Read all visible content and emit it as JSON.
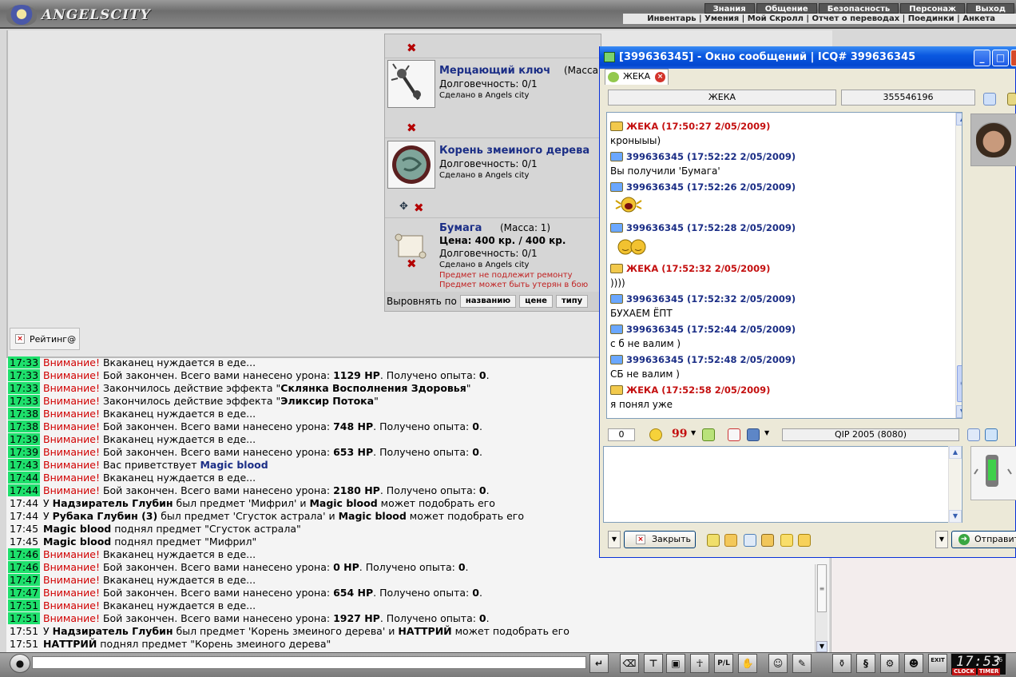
{
  "game": {
    "logo_text": "ANGELSCITY",
    "menu_top": [
      "Знания",
      "Общение",
      "Безопасность",
      "Персонаж",
      "Выход"
    ],
    "menu_sub": "Инвентарь | Умения | Мой Скролл | Отчет о переводах | Поединки | Анкета",
    "rating_label": "Рейтинг@",
    "inventory": {
      "items": [
        {
          "name": "Мерцающий ключ",
          "mass": "(Масса",
          "durability": "Долговечность: 0/1",
          "made": "Сделано в Angels city"
        },
        {
          "name": "Корень змеиного дерева",
          "durability": "Долговечность: 0/1",
          "made": "Сделано в Angels city"
        },
        {
          "name": "Бумага",
          "mass": "(Масса: 1)",
          "price": "Цена: 400 кр. / 400 кр.",
          "durability": "Долговечность: 0/1",
          "made": "Сделано в Angels city",
          "note1": "Предмет не подлежит ремонту",
          "note2": "Предмет может быть утерян в бою"
        }
      ],
      "sort_label": "Выровнять по",
      "sort_buttons": [
        "названию",
        "цене",
        "типу"
      ]
    },
    "chat": [
      {
        "time": "17:33",
        "hl": true,
        "parts": [
          [
            "w",
            "Внимание! "
          ],
          [
            "n",
            "Вкаканец нуждается в еде..."
          ]
        ]
      },
      {
        "time": "17:33",
        "hl": true,
        "parts": [
          [
            "w",
            "Внимание! "
          ],
          [
            "n",
            "Бой закончен. Всего вами нанесено урона: "
          ],
          [
            "b",
            "1129 HP"
          ],
          [
            "n",
            ". Получено опыта: "
          ],
          [
            "b",
            "0"
          ],
          [
            "n",
            "."
          ]
        ]
      },
      {
        "time": "17:33",
        "hl": true,
        "parts": [
          [
            "w",
            "Внимание! "
          ],
          [
            "n",
            "Закончилось действие эффекта \""
          ],
          [
            "b",
            "Склянка Восполнения Здоровья"
          ],
          [
            "n",
            "\""
          ]
        ]
      },
      {
        "time": "17:33",
        "hl": true,
        "parts": [
          [
            "w",
            "Внимание! "
          ],
          [
            "n",
            "Закончилось действие эффекта \""
          ],
          [
            "b",
            "Эликсир Потока"
          ],
          [
            "n",
            "\""
          ]
        ]
      },
      {
        "time": "17:38",
        "hl": true,
        "parts": [
          [
            "w",
            "Внимание! "
          ],
          [
            "n",
            "Вкаканец нуждается в еде..."
          ]
        ]
      },
      {
        "time": "17:38",
        "hl": true,
        "parts": [
          [
            "w",
            "Внимание! "
          ],
          [
            "n",
            "Бой закончен. Всего вами нанесено урона: "
          ],
          [
            "b",
            "748 HP"
          ],
          [
            "n",
            ". Получено опыта: "
          ],
          [
            "b",
            "0"
          ],
          [
            "n",
            "."
          ]
        ]
      },
      {
        "time": "17:39",
        "hl": true,
        "parts": [
          [
            "w",
            "Внимание! "
          ],
          [
            "n",
            "Вкаканец нуждается в еде..."
          ]
        ]
      },
      {
        "time": "17:39",
        "hl": true,
        "parts": [
          [
            "w",
            "Внимание! "
          ],
          [
            "n",
            "Бой закончен. Всего вами нанесено урона: "
          ],
          [
            "b",
            "653 HP"
          ],
          [
            "n",
            ". Получено опыта: "
          ],
          [
            "b",
            "0"
          ],
          [
            "n",
            "."
          ]
        ]
      },
      {
        "time": "17:43",
        "hl": true,
        "parts": [
          [
            "w",
            "Внимание! "
          ],
          [
            "n",
            "Вас приветствует "
          ],
          [
            "bl",
            "Magic blood"
          ]
        ]
      },
      {
        "time": "17:44",
        "hl": true,
        "parts": [
          [
            "w",
            "Внимание! "
          ],
          [
            "n",
            "Вкаканец нуждается в еде..."
          ]
        ]
      },
      {
        "time": "17:44",
        "hl": true,
        "parts": [
          [
            "w",
            "Внимание! "
          ],
          [
            "n",
            "Бой закончен. Всего вами нанесено урона: "
          ],
          [
            "b",
            "2180 HP"
          ],
          [
            "n",
            ". Получено опыта: "
          ],
          [
            "b",
            "0"
          ],
          [
            "n",
            "."
          ]
        ]
      },
      {
        "time": "17:44",
        "hl": false,
        "parts": [
          [
            "n",
            "У "
          ],
          [
            "b",
            "Надзиратель Глубин"
          ],
          [
            "n",
            " был предмет 'Мифрил' и "
          ],
          [
            "b",
            "Magic blood"
          ],
          [
            "n",
            " может подобрать его"
          ]
        ]
      },
      {
        "time": "17:44",
        "hl": false,
        "parts": [
          [
            "n",
            "У "
          ],
          [
            "b",
            "Рубака Глубин (3)"
          ],
          [
            "n",
            " был предмет 'Сгусток астрала' и "
          ],
          [
            "b",
            "Magic blood"
          ],
          [
            "n",
            " может подобрать его"
          ]
        ]
      },
      {
        "time": "17:45",
        "hl": false,
        "parts": [
          [
            "b",
            "Magic blood"
          ],
          [
            "n",
            " поднял предмет \"Сгусток астрала\""
          ]
        ]
      },
      {
        "time": "17:45",
        "hl": false,
        "parts": [
          [
            "b",
            "Magic blood"
          ],
          [
            "n",
            " поднял предмет \"Мифрил\""
          ]
        ]
      },
      {
        "time": "17:46",
        "hl": true,
        "parts": [
          [
            "w",
            "Внимание! "
          ],
          [
            "n",
            "Вкаканец нуждается в еде..."
          ]
        ]
      },
      {
        "time": "17:46",
        "hl": true,
        "parts": [
          [
            "w",
            "Внимание! "
          ],
          [
            "n",
            "Бой закончен. Всего вами нанесено урона: "
          ],
          [
            "b",
            "0 HP"
          ],
          [
            "n",
            ". Получено опыта: "
          ],
          [
            "b",
            "0"
          ],
          [
            "n",
            "."
          ]
        ]
      },
      {
        "time": "17:47",
        "hl": true,
        "parts": [
          [
            "w",
            "Внимание! "
          ],
          [
            "n",
            "Вкаканец нуждается в еде..."
          ]
        ]
      },
      {
        "time": "17:47",
        "hl": true,
        "parts": [
          [
            "w",
            "Внимание! "
          ],
          [
            "n",
            "Бой закончен. Всего вами нанесено урона: "
          ],
          [
            "b",
            "654 HP"
          ],
          [
            "n",
            ". Получено опыта: "
          ],
          [
            "b",
            "0"
          ],
          [
            "n",
            "."
          ]
        ]
      },
      {
        "time": "17:51",
        "hl": true,
        "parts": [
          [
            "w",
            "Внимание! "
          ],
          [
            "n",
            "Вкаканец нуждается в еде..."
          ]
        ]
      },
      {
        "time": "17:51",
        "hl": true,
        "parts": [
          [
            "w",
            "Внимание! "
          ],
          [
            "n",
            "Бой закончен. Всего вами нанесено урона: "
          ],
          [
            "b",
            "1927 HP"
          ],
          [
            "n",
            ". Получено опыта: "
          ],
          [
            "b",
            "0"
          ],
          [
            "n",
            "."
          ]
        ]
      },
      {
        "time": "17:51",
        "hl": false,
        "parts": [
          [
            "n",
            "У "
          ],
          [
            "b",
            "Надзиратель Глубин"
          ],
          [
            "n",
            " был предмет 'Корень змеиного дерева' и "
          ],
          [
            "b",
            "НАТТРИЙ"
          ],
          [
            "n",
            " может подобрать его"
          ]
        ]
      },
      {
        "time": "17:51",
        "hl": false,
        "parts": [
          [
            "b",
            "НАТТРИЙ"
          ],
          [
            "n",
            " поднял предмет \"Корень змеиного дерева\""
          ]
        ]
      }
    ],
    "toolbar_icons": [
      "pad-icon",
      "enter-icon",
      "eraser-icon",
      "filter-icon",
      "floppy-icon",
      "figure-icon",
      "pl-icon",
      "hand-icon",
      "smiley-icon",
      "broom-icon",
      "bottle-icon",
      "scroll-icon",
      "gear-icon",
      "people-icon",
      "exit-icon"
    ],
    "pl_label": "P/L",
    "exit_label": "EXIT",
    "clock": {
      "time": "17:53",
      "seconds": "26",
      "clock_label": "CLOCK",
      "timer_label": "TIMER"
    }
  },
  "qip": {
    "title": "[399636345] - Окно сообщений | ICQ# 399636345",
    "tab_label": "ЖЕКА",
    "contact_name": "ЖЕКА",
    "contact_uin": "355546196",
    "messages": [
      {
        "from": "they",
        "header": "ЖЕКА (17:50:27 2/05/2009)",
        "text": "кроныыы)"
      },
      {
        "from": "me",
        "header": "399636345 (17:52:22 2/05/2009)",
        "text": "Вы получили 'Бумага'"
      },
      {
        "from": "me",
        "header": "399636345 (17:52:26 2/05/2009)",
        "text": "",
        "smile": "scream"
      },
      {
        "from": "me",
        "header": "399636345 (17:52:28 2/05/2009)",
        "text": "",
        "smile": "hug"
      },
      {
        "from": "they",
        "header": "ЖЕКА (17:52:32 2/05/2009)",
        "text": "))))"
      },
      {
        "from": "me",
        "header": "399636345 (17:52:32 2/05/2009)",
        "text": "БУХАЕМ ЁПТ"
      },
      {
        "from": "me",
        "header": "399636345 (17:52:44 2/05/2009)",
        "text": "с б не валим )"
      },
      {
        "from": "me",
        "header": "399636345 (17:52:48 2/05/2009)",
        "text": "СБ не валим )"
      },
      {
        "from": "they",
        "header": "ЖЕКА (17:52:58 2/05/2009)",
        "text": "я понял уже"
      }
    ],
    "char_count": "0",
    "client_version": "QIP 2005 (8080)",
    "close_label": "Закрыть",
    "send_label": "Отправить",
    "accent": "#0a58e0"
  }
}
